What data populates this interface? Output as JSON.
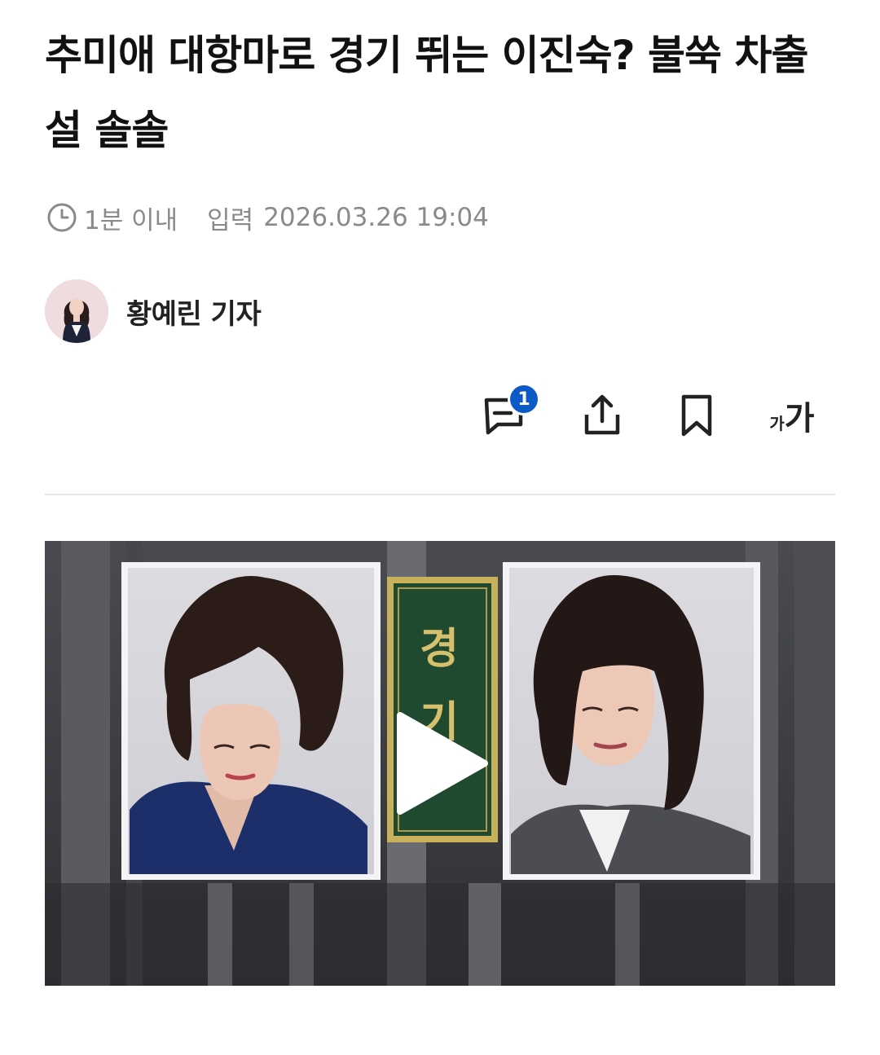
{
  "article": {
    "headline": "추미애 대항마로 경기 뛰는 이진숙? 불쑥 차출설 솔솔",
    "read_time": "1분 이내",
    "input_label": "입력",
    "input_datetime": "2026.03.26 19:04",
    "author_name": "황예린 기자"
  },
  "toolbar": {
    "comment_count": "1",
    "font_size_small": "가",
    "font_size_large": "가"
  },
  "video": {
    "placard_text": "경기"
  },
  "icons": {
    "clock": "clock-icon",
    "comment": "comment-icon",
    "share": "share-icon",
    "bookmark": "bookmark-icon",
    "font_size": "font-size-icon",
    "play": "play-icon"
  },
  "colors": {
    "badge": "#0c5ac8",
    "meta_text": "#8a8a8a",
    "placard_green": "#1f4a2f",
    "placard_gold": "#c8b15a"
  }
}
